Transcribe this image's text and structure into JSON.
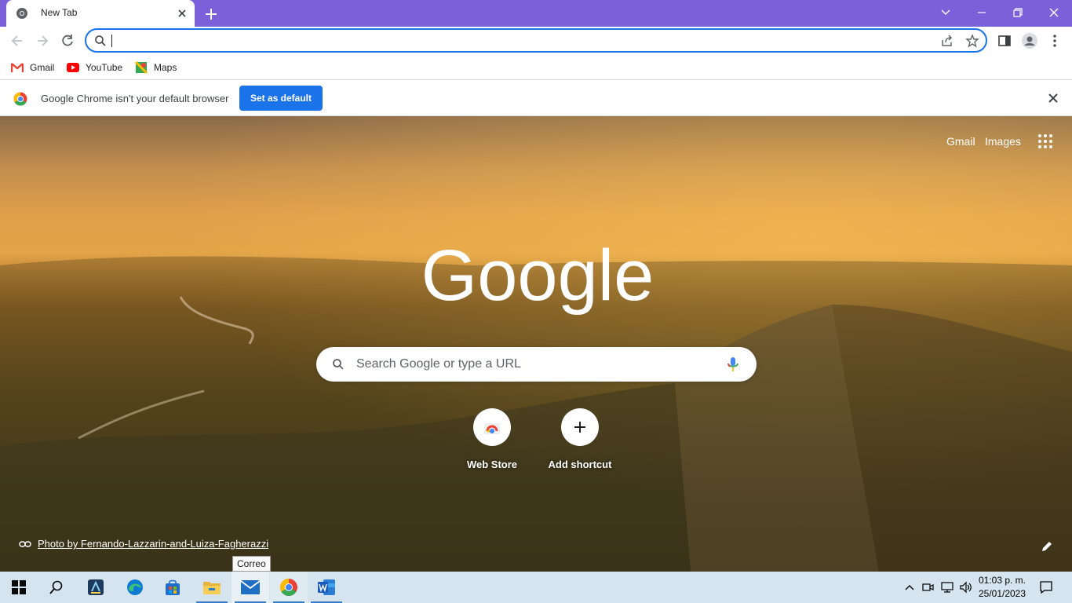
{
  "browser": {
    "tab_title": "New Tab",
    "address_value": "",
    "address_placeholder": ""
  },
  "bookmarks": [
    {
      "label": "Gmail"
    },
    {
      "label": "YouTube"
    },
    {
      "label": "Maps"
    }
  ],
  "infobar": {
    "message": "Google Chrome isn't your default browser",
    "button_label": "Set as default"
  },
  "ntp": {
    "top_links": [
      "Gmail",
      "Images"
    ],
    "logo_text": "Google",
    "search_placeholder": "Search Google or type a URL",
    "shortcuts": [
      {
        "label": "Web Store"
      },
      {
        "label": "Add shortcut"
      }
    ],
    "attribution": "Photo by Fernando-Lazzarin-and-Luiza-Fagherazzi"
  },
  "tooltip": "Correo",
  "taskbar": {
    "time": "01:03 p. m.",
    "date": "25/01/2023",
    "apps": [
      "start",
      "search",
      "app-store-ish",
      "edge",
      "microsoft-store",
      "file-explorer",
      "mail",
      "chrome",
      "word"
    ]
  },
  "colors": {
    "tab_bar": "#7b61d9",
    "accent": "#1a73e8",
    "taskbar": "#d5e4ef"
  }
}
